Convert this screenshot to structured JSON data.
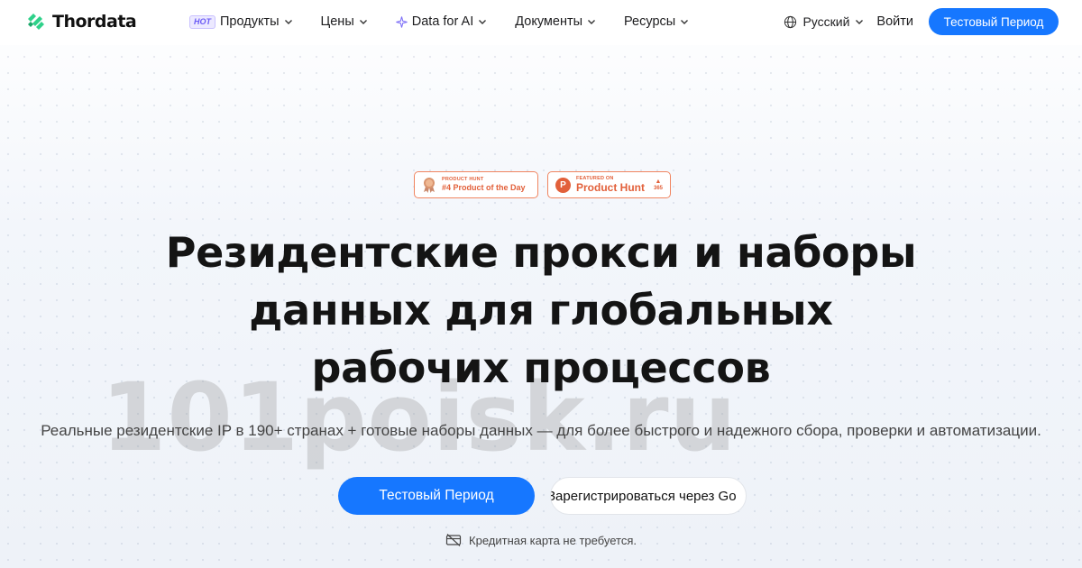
{
  "brand": {
    "name": "Thordata",
    "accent": "#1677ff",
    "logo_color": "#2fd18a"
  },
  "nav": {
    "items": [
      {
        "label": "Продукты",
        "badge": "HOT"
      },
      {
        "label": "Цены"
      },
      {
        "label": "Data for AI"
      },
      {
        "label": "Документы"
      },
      {
        "label": "Ресурсы"
      }
    ],
    "language": "Русский",
    "login": "Войти",
    "trial_button": "Тестовый Период"
  },
  "badges": {
    "product_hunt_day": {
      "small": "PRODUCT HUNT",
      "big": "#4 Product of the Day"
    },
    "product_hunt_featured": {
      "small": "FEATURED ON",
      "big": "Product Hunt",
      "votes": "365"
    }
  },
  "hero": {
    "headline_line1": "Резидентские прокси и наборы",
    "headline_line2": "данных для глобальных",
    "headline_line3": "рабочих процессов",
    "subtitle": "Реальные резидентские IP в 190+ странах + готовые наборы данных — для более быстрого и надежного сбора, проверки и автоматизации.",
    "cta_primary": "Тестовый Период",
    "cta_google": "Зарегистрироваться через Go",
    "no_card": "Кредитная карта не требуется."
  },
  "watermark": "101poisk.ru"
}
